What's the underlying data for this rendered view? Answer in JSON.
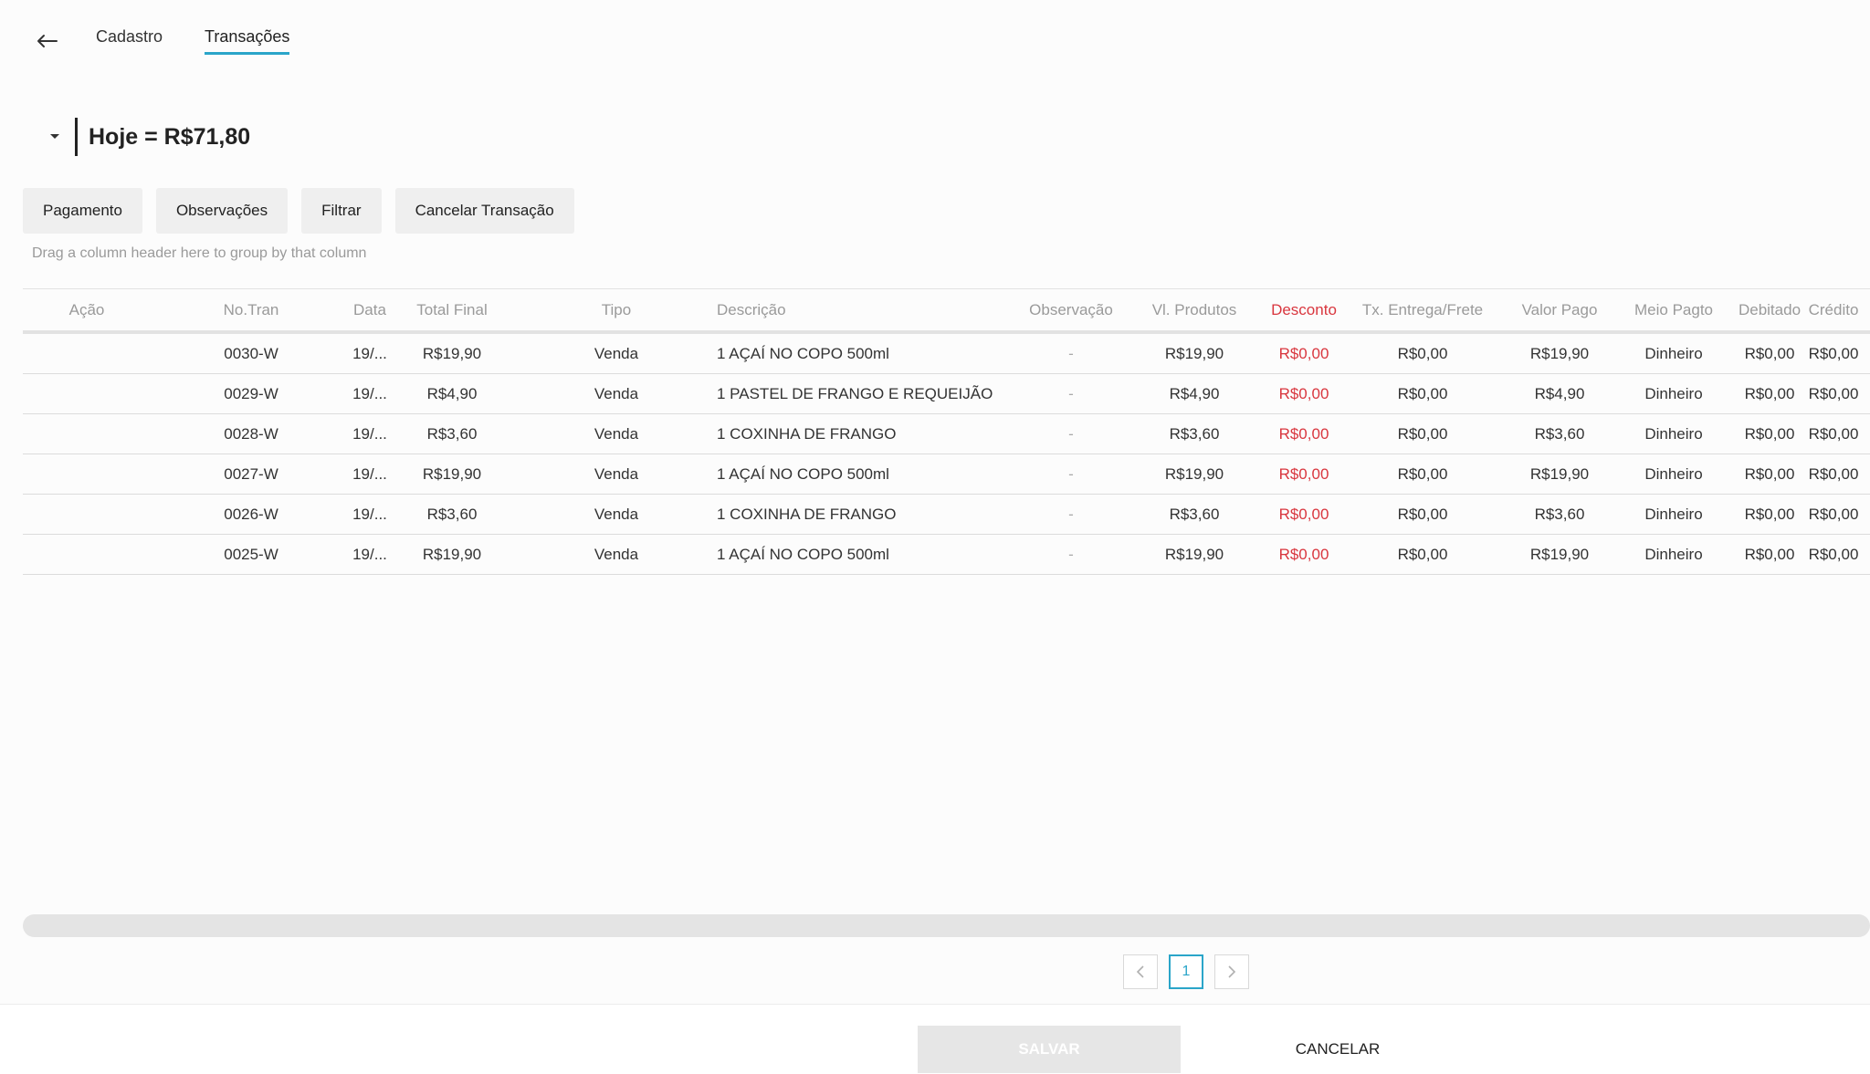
{
  "tabs": {
    "cadastro": "Cadastro",
    "transacoes": "Transações"
  },
  "summary": {
    "title": "Hoje = R$71,80"
  },
  "toolbar": {
    "pagamento": "Pagamento",
    "observacoes": "Observações",
    "filtrar": "Filtrar",
    "cancelar_transacao": "Cancelar Transação"
  },
  "group_hint": "Drag a column header here to group by that column",
  "table": {
    "headers": {
      "acao": "Ação",
      "notran": "No.Tran",
      "data": "Data",
      "total": "Total Final",
      "tipo": "Tipo",
      "descricao": "Descrição",
      "observacao": "Observação",
      "vlprodutos": "Vl. Produtos",
      "desconto": "Desconto",
      "txentrega": "Tx. Entrega/Frete",
      "valorpago": "Valor Pago",
      "meiopagto": "Meio Pagto",
      "debitado": "Debitado",
      "credito": "Crédito"
    },
    "rows": [
      {
        "notran": "0030-W",
        "data": "19/...",
        "total": "R$19,90",
        "tipo": "Venda",
        "descricao": "1 AÇAÍ NO COPO 500ml",
        "observacao": "-",
        "vlprodutos": "R$19,90",
        "desconto": "R$0,00",
        "txentrega": "R$0,00",
        "valorpago": "R$19,90",
        "meiopagto": "Dinheiro",
        "debitado": "R$0,00",
        "credito": "R$0,00"
      },
      {
        "notran": "0029-W",
        "data": "19/...",
        "total": "R$4,90",
        "tipo": "Venda",
        "descricao": "1 PASTEL DE FRANGO E REQUEIJÃO",
        "observacao": "-",
        "vlprodutos": "R$4,90",
        "desconto": "R$0,00",
        "txentrega": "R$0,00",
        "valorpago": "R$4,90",
        "meiopagto": "Dinheiro",
        "debitado": "R$0,00",
        "credito": "R$0,00"
      },
      {
        "notran": "0028-W",
        "data": "19/...",
        "total": "R$3,60",
        "tipo": "Venda",
        "descricao": "1 COXINHA DE FRANGO",
        "observacao": "-",
        "vlprodutos": "R$3,60",
        "desconto": "R$0,00",
        "txentrega": "R$0,00",
        "valorpago": "R$3,60",
        "meiopagto": "Dinheiro",
        "debitado": "R$0,00",
        "credito": "R$0,00"
      },
      {
        "notran": "0027-W",
        "data": "19/...",
        "total": "R$19,90",
        "tipo": "Venda",
        "descricao": "1 AÇAÍ NO COPO 500ml",
        "observacao": "-",
        "vlprodutos": "R$19,90",
        "desconto": "R$0,00",
        "txentrega": "R$0,00",
        "valorpago": "R$19,90",
        "meiopagto": "Dinheiro",
        "debitado": "R$0,00",
        "credito": "R$0,00"
      },
      {
        "notran": "0026-W",
        "data": "19/...",
        "total": "R$3,60",
        "tipo": "Venda",
        "descricao": "1 COXINHA DE FRANGO",
        "observacao": "-",
        "vlprodutos": "R$3,60",
        "desconto": "R$0,00",
        "txentrega": "R$0,00",
        "valorpago": "R$3,60",
        "meiopagto": "Dinheiro",
        "debitado": "R$0,00",
        "credito": "R$0,00"
      },
      {
        "notran": "0025-W",
        "data": "19/...",
        "total": "R$19,90",
        "tipo": "Venda",
        "descricao": "1 AÇAÍ NO COPO 500ml",
        "observacao": "-",
        "vlprodutos": "R$19,90",
        "desconto": "R$0,00",
        "txentrega": "R$0,00",
        "valorpago": "R$19,90",
        "meiopagto": "Dinheiro",
        "debitado": "R$0,00",
        "credito": "R$0,00"
      }
    ]
  },
  "pagination": {
    "current_page": "1",
    "prev_icon": "chevron-left-icon",
    "next_icon": "chevron-right-icon"
  },
  "footer": {
    "save": "SALVAR",
    "cancel": "CANCELAR"
  },
  "colors": {
    "accent": "#2aa5c9",
    "discount_red": "#d9363e",
    "button_bg": "#efefef"
  },
  "icons": {
    "back": "arrow-left-icon",
    "collapse": "caret-down-icon"
  }
}
